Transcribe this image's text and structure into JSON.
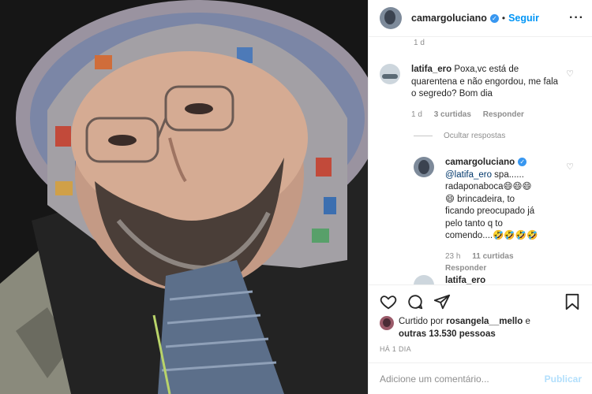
{
  "author": {
    "username": "camargoluciano",
    "follow_label": "Seguir",
    "more_icon": "more-icon"
  },
  "top_timestamp": "1 d",
  "comments": [
    {
      "username": "latifa_ero",
      "text": "Poxa,vc está de quarentena e não engordou, me fala o segredo? Bom dia",
      "time": "1 d",
      "likes": "3 curtidas",
      "reply_label": "Responder",
      "hide_replies": "Ocultar respostas",
      "replies": [
        {
          "username": "camargoluciano",
          "mention": "@latifa_ero",
          "text_line1": " spa......",
          "text_line2": "radaponaboca😄😄😄",
          "text_line3": "😄 brincadeira, to",
          "text_line4": "ficando preocupado já",
          "text_line5": "pelo tanto q to",
          "text_line6": "comendo....🤣🤣🤣🤣",
          "time": "23 h",
          "likes": "11 curtidas",
          "reply_label": "Responder"
        },
        {
          "username": "latifa_ero"
        }
      ]
    }
  ],
  "likes": {
    "prefix": "Curtido por",
    "user": "rosangela__mello",
    "connector": "e",
    "others": "outras 13.530 pessoas"
  },
  "posted": "HÁ 1 DIA",
  "add_comment": {
    "placeholder": "Adicione um comentário...",
    "post_label": "Publicar"
  },
  "colors": {
    "accent": "#0095f6",
    "verified": "#3897f0",
    "muted": "#8e8e8e"
  }
}
